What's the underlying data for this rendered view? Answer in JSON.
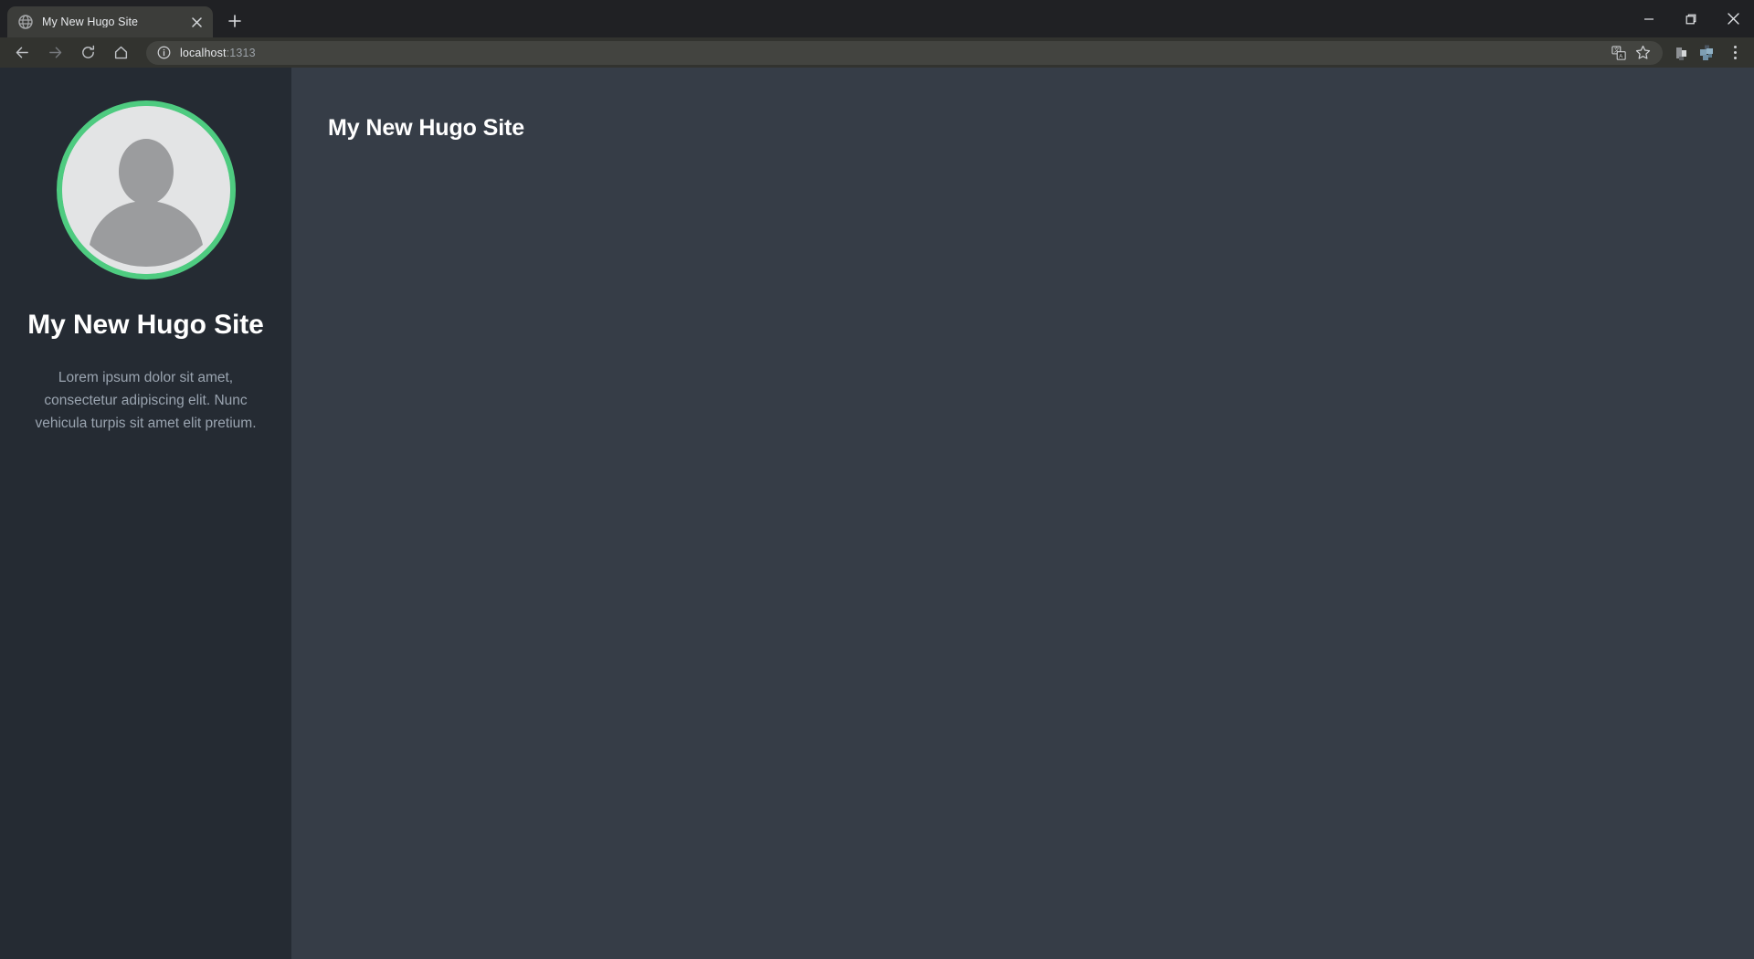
{
  "browser": {
    "tabs": [
      {
        "title": "My New Hugo Site",
        "favicon": "globe-icon",
        "close_label": "×",
        "active": true
      }
    ],
    "new_tab_label": "+",
    "window_controls": {
      "minimize": "minimize-icon",
      "maximize": "restore-icon",
      "close": "close-icon"
    },
    "toolbar": {
      "back": "back-arrow-icon",
      "forward": "forward-arrow-icon",
      "reload": "reload-icon",
      "home": "home-icon",
      "site_info": "info-circle-icon",
      "url_host": "localhost",
      "url_port": ":1313",
      "url_full": "localhost:1313",
      "translate": "translate-icon",
      "bookmark": "star-icon",
      "extension_one": "extension-icon",
      "extension_two": "extension-icon",
      "menu": "three-dot-menu-icon"
    }
  },
  "page": {
    "sidebar": {
      "avatar": "user-avatar-placeholder",
      "avatar_ring_color": "#4ecb80",
      "title": "My New Hugo Site",
      "description": "Lorem ipsum dolor sit amet, consectetur adipiscing elit. Nunc vehicula turpis sit amet elit pretium."
    },
    "main": {
      "heading": "My New Hugo Site"
    },
    "colors": {
      "sidebar_bg": "#252b33",
      "content_bg": "#363d47",
      "accent": "#4ecb80",
      "heading": "#ffffff",
      "muted_text": "#9aa4b0"
    }
  }
}
